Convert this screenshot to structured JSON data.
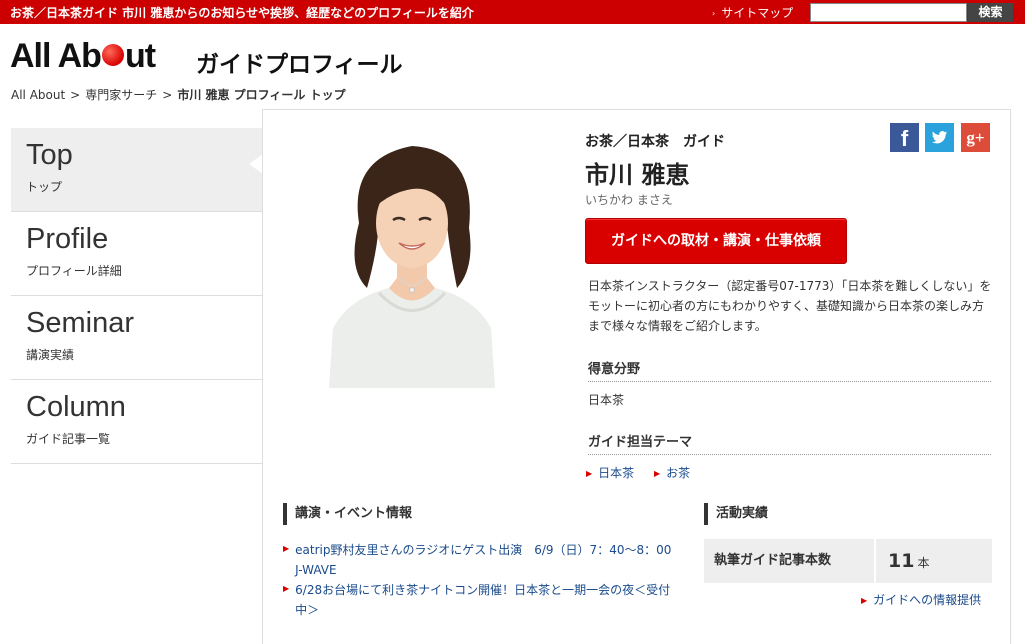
{
  "topbar": {
    "tagline": "お茶／日本茶ガイド 市川 雅恵からのお知らせや挨拶、経歴などのプロフィールを紹介",
    "sitemap_label": "サイトマップ",
    "search_placeholder": "",
    "search_button": "検索"
  },
  "header": {
    "logo_text_1": "All Ab",
    "logo_text_2": "ut",
    "section_title": "ガイドプロフィール"
  },
  "breadcrumb": {
    "items": [
      "All About",
      "専門家サーチ",
      "市川 雅恵 プロフィール トップ"
    ],
    "separator": ">"
  },
  "sidebar": {
    "items": [
      {
        "en": "Top",
        "ja": "トップ",
        "active": true
      },
      {
        "en": "Profile",
        "ja": "プロフィール詳細",
        "active": false
      },
      {
        "en": "Seminar",
        "ja": "講演実績",
        "active": false
      },
      {
        "en": "Column",
        "ja": "ガイド記事一覧",
        "active": false
      }
    ]
  },
  "profile": {
    "genre": "お茶／日本茶　ガイド",
    "name": "市川 雅恵",
    "kana": "いちかわ まさえ",
    "contact_button": "ガイドへの取材・講演・仕事依頼",
    "intro": "日本茶インストラクター（認定番号07-1773）「日本茶を難しくしない」をモットーに初心者の方にもわかりやすく、基礎知識から日本茶の楽しみ方まで様々な情報をご紹介します。",
    "field_heading": "得意分野",
    "field_value": "日本茶",
    "theme_heading": "ガイド担当テーマ",
    "themes": [
      "日本茶",
      "お茶"
    ]
  },
  "social": {
    "facebook": "f",
    "twitter_icon": "twitter-bird",
    "googleplus": "g+"
  },
  "events": {
    "heading": "講演・イベント情報",
    "items": [
      "eatrip野村友里さんのラジオにゲスト出演　6/9（日）7：40～8：00　J-WAVE",
      "6/28お台場にて利き茶ナイトコン開催！日本茶と一期一会の夜＜受付中＞"
    ]
  },
  "activity": {
    "heading": "活動実績",
    "label": "執筆ガイド記事本数",
    "count": "11",
    "unit": "本",
    "info_link": "ガイドへの情報提供"
  },
  "colors": {
    "brand_red": "#cc0000",
    "link_blue": "#1a4b8c"
  }
}
